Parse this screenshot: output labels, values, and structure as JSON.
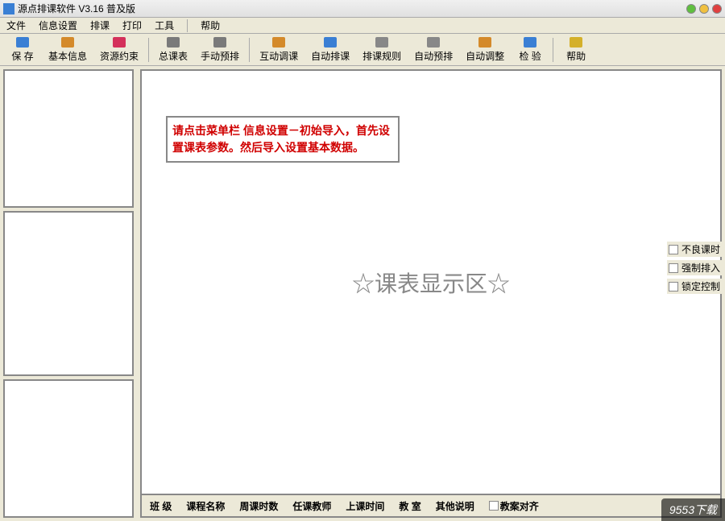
{
  "title": "源点排课软件 V3.16 普及版",
  "menus": [
    "文件",
    "信息设置",
    "排课",
    "打印",
    "工具",
    "帮助"
  ],
  "toolbar": [
    {
      "label": "保 存",
      "icon": "save",
      "color": "#3a7fd4"
    },
    {
      "label": "基本信息",
      "icon": "info",
      "color": "#d48a2a"
    },
    {
      "label": "资源约束",
      "icon": "resource",
      "color": "#d4305a"
    },
    {
      "sep": true
    },
    {
      "label": "总课表",
      "icon": "table",
      "color": "#7a7a7a"
    },
    {
      "label": "手动预排",
      "icon": "manual",
      "color": "#7a7a7a"
    },
    {
      "sep": true
    },
    {
      "label": "互动调课",
      "icon": "swap",
      "color": "#d48a2a"
    },
    {
      "label": "自动排课",
      "icon": "auto",
      "color": "#3a7fd4"
    },
    {
      "label": "排课规则",
      "icon": "rules",
      "color": "#888"
    },
    {
      "label": "自动预排",
      "icon": "autopre",
      "color": "#888"
    },
    {
      "label": "自动调整",
      "icon": "adjust",
      "color": "#d48a2a"
    },
    {
      "label": "检 验",
      "icon": "check",
      "color": "#3a7fd4"
    },
    {
      "sep": true
    },
    {
      "label": "帮助",
      "icon": "help",
      "color": "#d4b02a"
    }
  ],
  "hint": "请点击菜单栏 信息设置－初始导入，首先设置课表参数。然后导入设置基本数据。",
  "center": "☆课表显示区☆",
  "checkboxes": [
    "不良课时",
    "强制排入",
    "锁定控制"
  ],
  "footer": {
    "cols": [
      "班  级",
      "课程名称",
      "周课时数",
      "任课教师",
      "上课时间",
      "教  室",
      "其他说明"
    ],
    "check": "教案对齐"
  },
  "watermark": "9553下载"
}
